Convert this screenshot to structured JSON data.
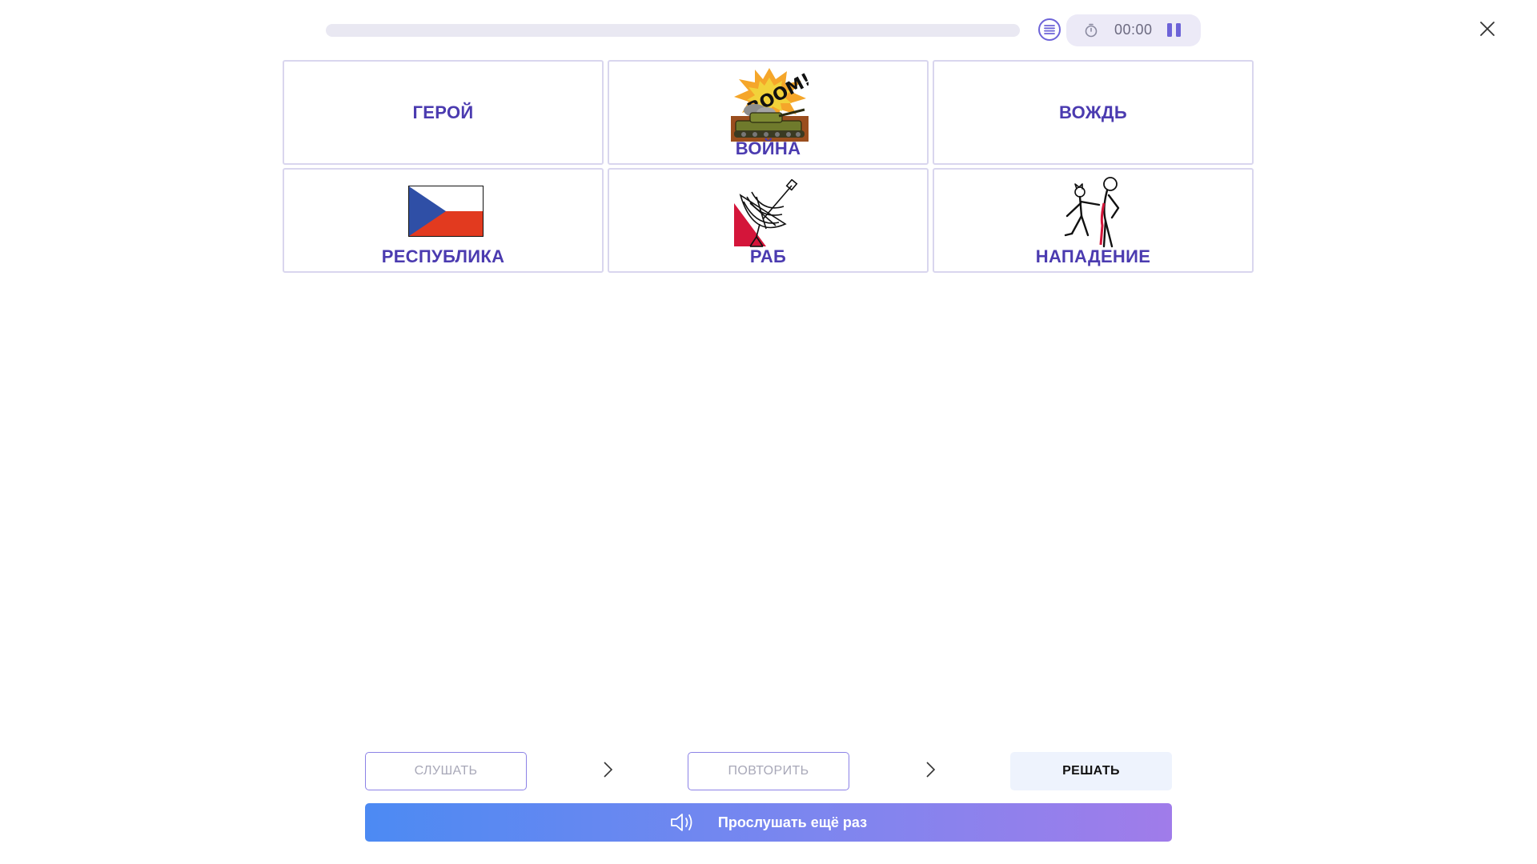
{
  "header": {
    "progress": 0,
    "timer": "00:00",
    "icons": {
      "list": "list-icon",
      "timer": "stopwatch-icon",
      "pause": "pause-icon",
      "close": "close-icon"
    }
  },
  "cards": [
    {
      "label": "ГЕРОЙ",
      "image": null
    },
    {
      "label": "ВОЙНА",
      "image": "tank-explosion-image"
    },
    {
      "label": "ВОЖДЬ",
      "image": null
    },
    {
      "label": "РЕСПУБЛИКА",
      "image": "czech-flag-image"
    },
    {
      "label": "РАБ",
      "image": "satellite-dish-image"
    },
    {
      "label": "НАПАДЕНИЕ",
      "image": "attack-figures-image"
    }
  ],
  "steps": {
    "listen": "СЛУШАТЬ",
    "repeat": "ПОВТОРИТЬ",
    "solve": "РЕШАТЬ"
  },
  "play_again": {
    "label": "Прослушать ещё раз",
    "icon": "speaker-icon"
  },
  "colors": {
    "accent": "#6d63d8",
    "card_text": "#4b3bb0",
    "button_gradient_start": "#4c8af3",
    "button_gradient_end": "#a07cea"
  }
}
